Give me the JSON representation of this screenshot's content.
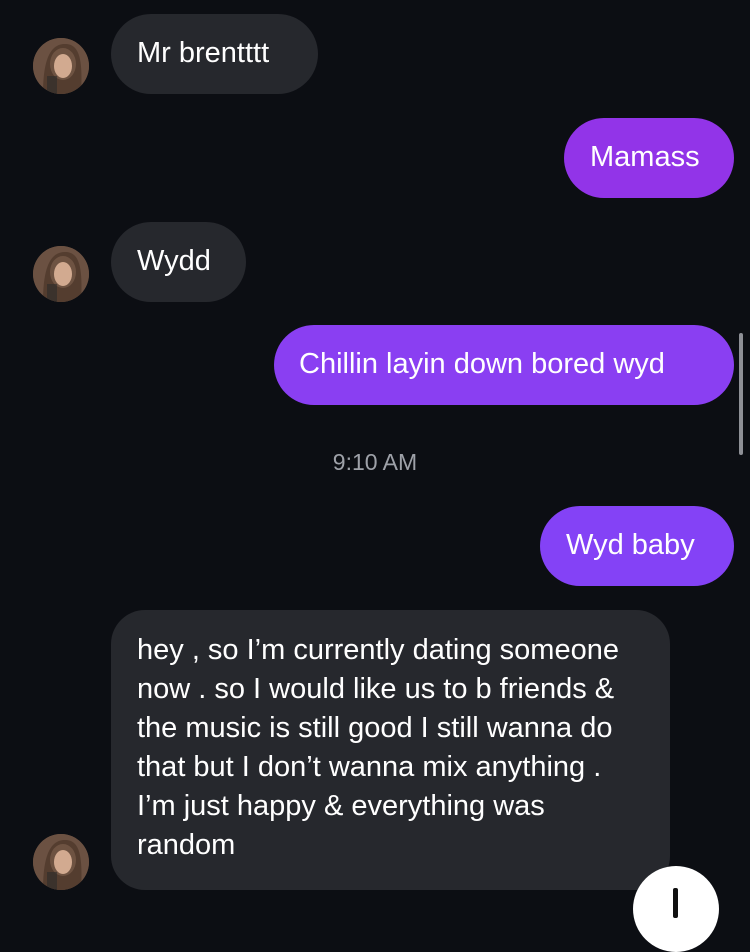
{
  "theme": {
    "background": "#0c0e13",
    "incoming_bubble": "#26282d",
    "outgoing_bubble": "#8c3ff0",
    "timestamp_color": "#9ea1a8"
  },
  "messages": [
    {
      "sender": "them",
      "text": "Mr brentttt"
    },
    {
      "sender": "me",
      "text": "Mamass"
    },
    {
      "sender": "them",
      "text": "Wydd"
    },
    {
      "sender": "me",
      "text": "Chillin layin down bored wyd"
    },
    {
      "sender": "me",
      "text": "Wyd baby"
    },
    {
      "sender": "them",
      "text": "hey , so I’m currently dating someone now . so I would like us to b friends & the music is still good I still wanna do that but I don’t wanna mix anything . I’m just happy & everything was random"
    }
  ],
  "timestamp": "9:10 AM",
  "icons": {
    "avatar": "contact-avatar",
    "scroll_down": "arrow-down-icon"
  }
}
